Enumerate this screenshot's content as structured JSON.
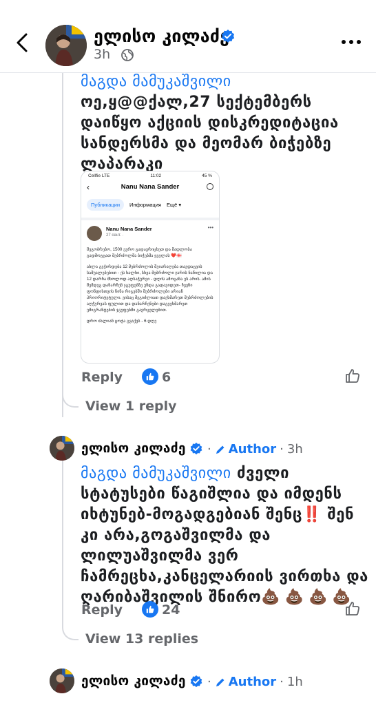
{
  "header": {
    "author_name": "ელისო კილაძე",
    "time": "3h"
  },
  "comment1": {
    "mention": "მაგდა მამუკაშვილი",
    "text": "ოე,ყ@@ქალ,27 სექტემბერს დაიწყო აქციის დისკრედიტაცია სანდერსმა და მეომარ ბიჭებზე ლაპარაკი",
    "reply_label": "Reply",
    "likes": "6",
    "view_replies": "View 1 reply",
    "embed": {
      "carrier": "Cellfie  LTE",
      "clock": "11:02",
      "battery": "45 %",
      "page_title": "Nanu Nana Sander",
      "tab_posts": "Публикации",
      "tab_info": "Информация",
      "tab_more": "Ещё ▾",
      "post_author": "Nanu Nana Sander",
      "post_date": "27 сент. · ",
      "post_p1": "მეგობრებო, 1500 ევრო გადავრიცხეთ და მადლობა გადმოგცათ მებრძოლმა ბიჭებმა ყველას ❤️🇬🇪",
      "post_p2": "ახლა გვჭირდება 12 მებრძოლის შეიარაღება თავდაცვის საშუალებებით - ეს ხალხი, სხვა მებრძოლი ჯარის ნაწილია და 12 დარჩა მხოლოდ აღსაჭურვი - დღის ამოცანა ეს არის. ამის შემდეგ დანარჩენ ჯგუფებზე უნდა გადავიდეთ- ჩვენი ფონდისთვის ნინა რიგებში მებრძოლები არიან პრიორიტეტული. ვისაც შეგიძლიათ დაეხმარეთ მებრძოლების აღჭურვას ფულით და დანარჩენები დაგვეხმარეთ ემიგრანტების ჯგუფებში გავრცელებით.",
      "post_p3": "დრო ძალიან ცოტა გვაქვს - 6 დღე"
    }
  },
  "comment2": {
    "author_name": "ელისო კილაძე",
    "author_badge": "Author",
    "time": "3h",
    "mention": "მაგდა მამუკაშვილი",
    "text_a": " ძველი სტატუსები წაგიშლია და იმდენს იხტუნებ-მოგადგებიან შენც",
    "exclaim": "‼️",
    "text_b": " შენ კი არა,გოგაშვილმა და ლილუაშვილმა ვერ ჩამრეცხა,კანცელარიის ვირთხა და ღარიბაშვილის შნირო",
    "emojis": "💩 💩 💩 💩",
    "reply_label": "Reply",
    "likes": "24",
    "view_replies": "View 13 replies"
  },
  "comment3": {
    "author_name": "ელისო კილაძე",
    "author_badge": "Author",
    "time": "1h"
  },
  "colors": {
    "link_blue": "#1877f2",
    "muted": "#65676b",
    "thread_line": "#d8dadf"
  },
  "icons": [
    "back-chevron-icon",
    "verified-badge-icon",
    "globe-icon",
    "more-dots-icon",
    "like-thumb-icon",
    "pencil-icon"
  ]
}
